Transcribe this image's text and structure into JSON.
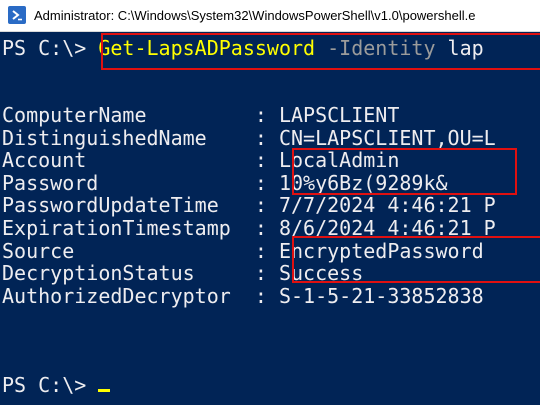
{
  "window": {
    "title": "Administrator: C:\\Windows\\System32\\WindowsPowerShell\\v1.0\\powershell.e",
    "icon": "powershell-icon"
  },
  "console": {
    "prompt": "PS C:\\> ",
    "command": "Get-LapsADPassword",
    "param": "-Identity",
    "arg": "lap",
    "rows": [
      {
        "key": "ComputerName         ",
        "sep": ": ",
        "value": "LAPSCLIENT"
      },
      {
        "key": "DistinguishedName    ",
        "sep": ": ",
        "value": "CN=LAPSCLIENT,OU=L"
      },
      {
        "key": "Account              ",
        "sep": ": ",
        "value": "LocalAdmin"
      },
      {
        "key": "Password             ",
        "sep": ": ",
        "value": "10%y6Bz(9289k&"
      },
      {
        "key": "PasswordUpdateTime   ",
        "sep": ": ",
        "value": "7/7/2024 4:46:21 P"
      },
      {
        "key": "ExpirationTimestamp  ",
        "sep": ": ",
        "value": "8/6/2024 4:46:21 P"
      },
      {
        "key": "Source               ",
        "sep": ": ",
        "value": "EncryptedPassword"
      },
      {
        "key": "DecryptionStatus     ",
        "sep": ": ",
        "value": "Success"
      },
      {
        "key": "AuthorizedDecryptor  ",
        "sep": ": ",
        "value": "S-1-5-21-33852838"
      }
    ],
    "final_prompt": "PS C:\\> "
  },
  "colors": {
    "background": "#012456",
    "text": "#eeedf0",
    "command": "#ffff00",
    "parameter": "#9b9b9b",
    "highlight_box": "#e01010"
  }
}
